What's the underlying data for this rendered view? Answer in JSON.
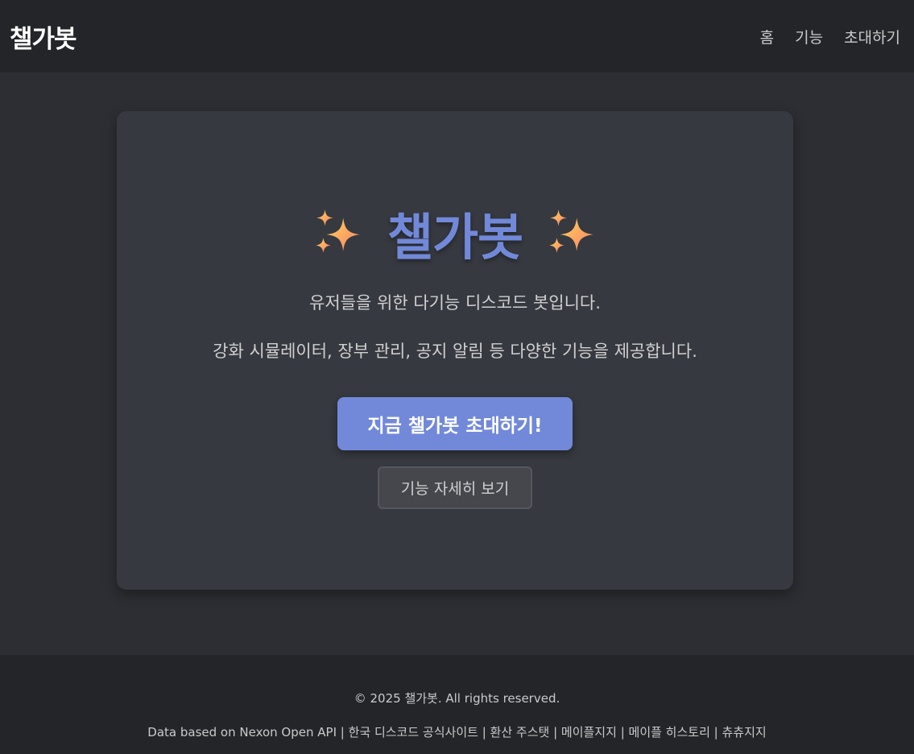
{
  "header": {
    "brand": "챌가봇",
    "nav": [
      "홈",
      "기능",
      "초대하기"
    ]
  },
  "hero": {
    "title": "챌가봇",
    "title_icon": "sparkles-icon",
    "desc1": "유저들을 위한 다기능 디스코드 봇입니다.",
    "desc2": "강화 시뮬레이터, 장부 관리, 공지 알림 등 다양한 기능을 제공합니다.",
    "primary_button": "지금 챌가봇 초대하기!",
    "secondary_button": "기능 자세히 보기"
  },
  "footer": {
    "copyright": "© 2025 챌가봇. All rights reserved.",
    "data_source": "Data based on Nexon Open API",
    "separator": " | ",
    "links": [
      "한국 디스코드 공식사이트",
      "환산 주스탯",
      "메이플지지",
      "메이플 히스토리",
      "츄츄지지"
    ]
  },
  "colors": {
    "accent": "#7289da",
    "background": "#2c2e33",
    "card": "#36393f",
    "bar": "#232528"
  }
}
